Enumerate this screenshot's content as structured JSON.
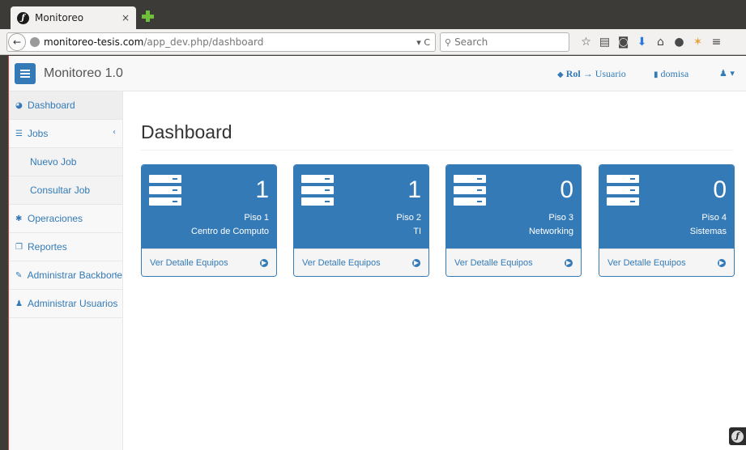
{
  "browser": {
    "tab_title": "Monitoreo",
    "tab_close": "×",
    "url_host": "monitoreo-tesis.com",
    "url_path": "/app_dev.php/dashboard",
    "url_controls": "▾ C",
    "search_placeholder": "Search",
    "toolbar_icons": [
      "star-icon",
      "reading-list-icon",
      "pocket-icon",
      "download-icon",
      "home-icon",
      "chat-icon",
      "extension-icon",
      "menu-icon"
    ]
  },
  "app": {
    "brand": "Monitoreo 1.0",
    "nav": {
      "rol": "Rol",
      "arrow": "→",
      "usuario": "Usuario",
      "user_name": "domisa"
    },
    "sidebar": [
      {
        "label": "Dashboard",
        "icon": "dashboard-icon"
      },
      {
        "label": "Jobs",
        "icon": "list-icon",
        "caret": "‹"
      },
      {
        "label": "Nuevo Job"
      },
      {
        "label": "Consultar Job"
      },
      {
        "label": "Operaciones",
        "icon": "gear-icon"
      },
      {
        "label": "Reportes",
        "icon": "copy-icon"
      },
      {
        "label": "Administrar Backbone",
        "icon": "wrench-icon",
        "caret": "‹"
      },
      {
        "label": "Administrar Usuarios",
        "icon": "user-icon"
      }
    ],
    "page_title": "Dashboard",
    "panels": [
      {
        "count": "1",
        "floor": "Piso 1",
        "area": "Centro de Computo",
        "link": "Ver Detalle Equipos"
      },
      {
        "count": "1",
        "floor": "Piso 2",
        "area": "TI",
        "link": "Ver Detalle Equipos"
      },
      {
        "count": "0",
        "floor": "Piso 3",
        "area": "Networking",
        "link": "Ver Detalle Equipos"
      },
      {
        "count": "0",
        "floor": "Piso 4",
        "area": "Sistemas",
        "link": "Ver Detalle Equipos"
      }
    ]
  },
  "colors": {
    "primary": "#337ab7",
    "navbar_bg": "#f8f8f8",
    "chrome_dark": "#3c3b37"
  }
}
